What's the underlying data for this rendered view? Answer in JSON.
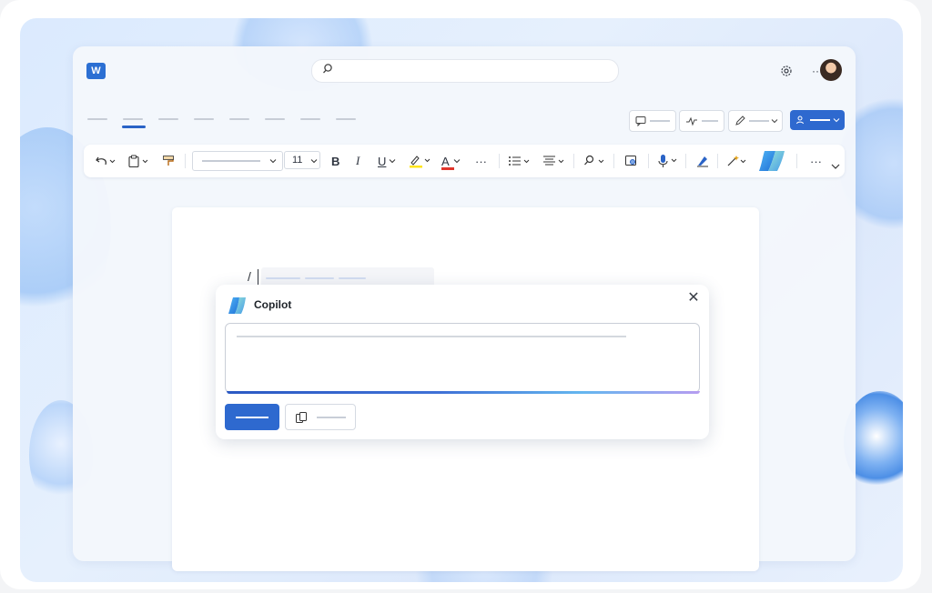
{
  "app": {
    "logo_letter": "W"
  },
  "ribbon": {
    "font_size": "11",
    "bold": "B",
    "italic": "I",
    "underline": "U",
    "font_color": "A",
    "more": "···"
  },
  "document": {
    "slash_command": "/"
  },
  "copilot": {
    "title": "Copilot",
    "close": "✕"
  },
  "colors": {
    "accent": "#2e69cf",
    "gradient": [
      "#2b59c3",
      "#64b6ef",
      "#b69cf0"
    ]
  },
  "icons": {
    "top_right": [
      "settings-icon",
      "more-icon",
      "avatar"
    ],
    "chips": [
      "comment-icon",
      "activity-icon",
      "edit-icon",
      "share-icon"
    ]
  }
}
